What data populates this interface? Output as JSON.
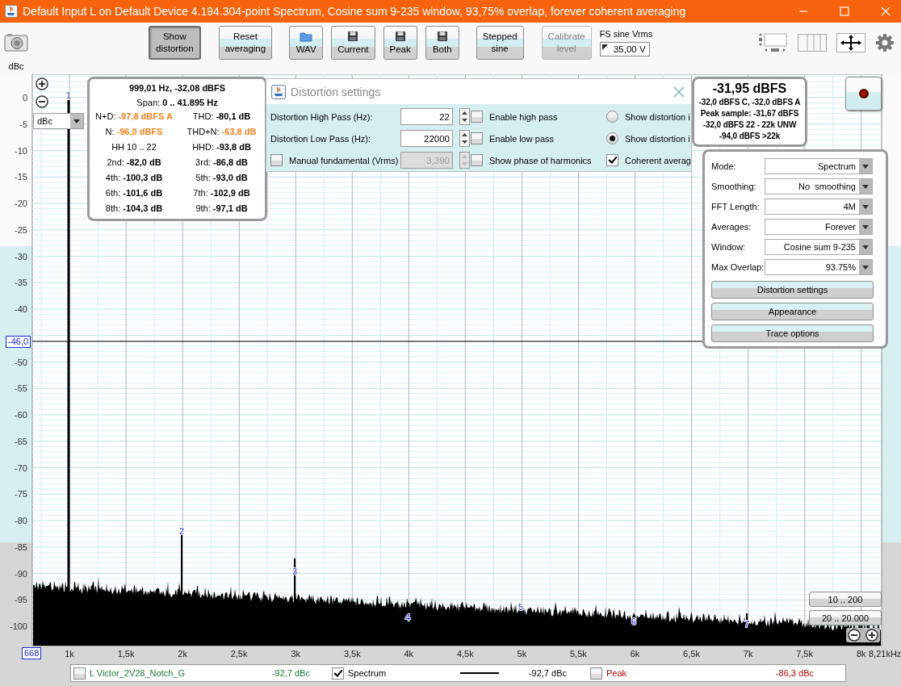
{
  "window": {
    "title": "Default Input L on Default Device 4.194.304-point Spectrum, Cosine sum 9-235 window, 93,75% overlap, forever coherent averaging"
  },
  "toolbar": {
    "groups": [
      {
        "buttons": [
          {
            "label": "Show distortion",
            "kind": "text",
            "selected": true,
            "disabled": false
          },
          {
            "label": "Reset averaging",
            "kind": "text",
            "selected": false,
            "disabled": false
          }
        ]
      },
      {
        "buttons": [
          {
            "label": "WAV",
            "kind": "folder",
            "selected": false,
            "disabled": false
          },
          {
            "label": "Current",
            "kind": "save",
            "selected": false,
            "disabled": false
          },
          {
            "label": "Peak",
            "kind": "save",
            "selected": false,
            "disabled": false
          },
          {
            "label": "Both",
            "kind": "save",
            "selected": false,
            "disabled": false
          }
        ]
      },
      {
        "buttons": [
          {
            "label": "Stepped sine",
            "kind": "text",
            "selected": false,
            "disabled": false
          },
          {
            "label": "Calibrate level",
            "kind": "text",
            "selected": false,
            "disabled": true
          }
        ]
      }
    ],
    "fs": {
      "label": "FS sine Vrms",
      "value": "35,00 V"
    }
  },
  "plot": {
    "y_unit": "dBc",
    "unit_select": "dBc",
    "y_ticks_upper": [
      "0",
      "-5",
      "-10",
      "-15",
      "-20",
      "-25",
      "-30",
      "-35",
      "-40"
    ],
    "y_ticks_lower": [
      "-50",
      "-55",
      "-60",
      "-65",
      "-70",
      "-75",
      "-80",
      "-85",
      "-90",
      "-95",
      "-100"
    ],
    "x_ticks": [
      "1k",
      "1,5k",
      "2k",
      "2,5k",
      "3k",
      "3,5k",
      "4k",
      "4,5k",
      "5k",
      "5,5k",
      "6k",
      "6,5k",
      "7k",
      "7,5k",
      "8k"
    ],
    "x_start": "668",
    "x_end": "8,21kHz",
    "cursor_value": "-46,0",
    "harmonic_labels": [
      "1",
      "2",
      "3",
      "4",
      "5",
      "6",
      "7"
    ],
    "range_buttons": [
      "10 .. 200",
      "20 .. 20.000"
    ]
  },
  "stats": {
    "title": "999,01 Hz, -32,08 dBFS",
    "span_label": "Span:",
    "span_value": "0 .. 41.895 Hz",
    "cells": [
      {
        "label": "N+D:",
        "value": "-97,8 dBFS A",
        "color": "#f5821f"
      },
      {
        "label": "THD:",
        "value": "-80,1 dB",
        "color": "#000000"
      },
      {
        "label": "N:",
        "value": "-96,0 dBFS",
        "color": "#f5821f"
      },
      {
        "label": "THD+N:",
        "value": "-63,8 dB",
        "color": "#f5821f"
      },
      {
        "label": "HH 10 .. 22"
      },
      {
        "label": "HHD:",
        "value": "-93,8 dB",
        "color": "#000000"
      },
      {
        "label": "2nd:",
        "value": "-82,0 dB",
        "color": "#000000"
      },
      {
        "label": "3rd:",
        "value": "-86,8 dB",
        "color": "#000000"
      },
      {
        "label": "4th:",
        "value": "-100,3 dB",
        "color": "#000000"
      },
      {
        "label": "5th:",
        "value": "-93,0 dB",
        "color": "#000000"
      },
      {
        "label": "6th:",
        "value": "-101,6 dB",
        "color": "#000000"
      },
      {
        "label": "7th:",
        "value": "-102,9 dB",
        "color": "#000000"
      },
      {
        "label": "8th:",
        "value": "-104,3 dB",
        "color": "#000000"
      },
      {
        "label": "9th:",
        "value": "-97,1 dB",
        "color": "#000000"
      }
    ]
  },
  "dialog": {
    "title": "Distortion settings",
    "rows": [
      {
        "field": {
          "kind": "label",
          "label": "Distortion High Pass (Hz):",
          "value": "22",
          "disabled": false
        },
        "option": {
          "label": "Enable high pass",
          "checked": false
        },
        "display": {
          "kind": "radio",
          "label": "Show distortion i",
          "selected": false
        }
      },
      {
        "field": {
          "kind": "label",
          "label": "Distortion Low Pass (Hz):",
          "value": "22000",
          "disabled": false
        },
        "option": {
          "label": "Enable low pass",
          "checked": false
        },
        "display": {
          "kind": "radio",
          "label": "Show distortion i",
          "selected": true
        }
      },
      {
        "field": {
          "kind": "checkbox",
          "label": "Manual fundamental (Vrms)",
          "checked": false,
          "value": "3,390",
          "disabled": true
        },
        "option": {
          "label": "Show phase of harmonics",
          "checked": false
        },
        "display": {
          "kind": "checkbox",
          "label": "Coherent averag",
          "checked": true
        }
      }
    ]
  },
  "level": {
    "reading": "-31,95 dBFS",
    "details": [
      "-32,0 dBFS C, -32,0 dBFS A",
      "Peak sample: -31,67 dBFS",
      "-32,0 dBFS 22 - 22k UNW",
      "-94,0 dBFS >22k"
    ]
  },
  "settings": {
    "rows": [
      {
        "label": "Mode:",
        "value": "Spectrum"
      },
      {
        "label": "Smoothing:",
        "value": "No  smoothing"
      },
      {
        "label": "FFT Length:",
        "value": "4M"
      },
      {
        "label": "Averages:",
        "value": "Forever"
      },
      {
        "label": "Window:",
        "value": "Cosine sum 9-235"
      },
      {
        "label": "Max Overlap:",
        "value": "93.75%"
      }
    ],
    "buttons": [
      "Distortion settings",
      "Appearance",
      "Trace options"
    ]
  },
  "legend": {
    "items": [
      {
        "name": "L Victor_2V28_Notch_G",
        "kind": "plain",
        "checked": false,
        "color": "#1e7b34",
        "value": "-92,7 dBc"
      },
      {
        "name": "Spectrum",
        "kind": "line",
        "checked": true,
        "color": "#000000",
        "value": "-92,7 dBc"
      },
      {
        "name": "Peak",
        "kind": "plain",
        "checked": false,
        "color": "#c00000",
        "value": "-86,3 dBc"
      }
    ]
  }
}
